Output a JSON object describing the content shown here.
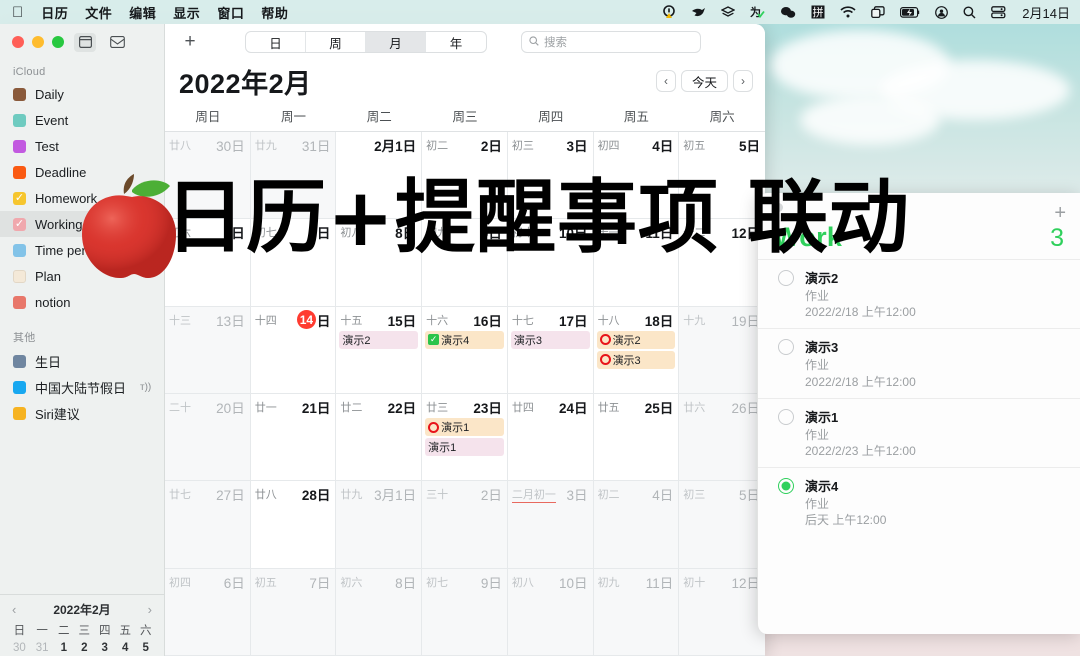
{
  "menubar": {
    "apple_icon": "apple-logo",
    "items": [
      "日历",
      "文件",
      "编辑",
      "显示",
      "窗口",
      "帮助"
    ],
    "status_icons": [
      "warning-badge-icon",
      "bird-icon",
      "layers-icon",
      "shield-check-icon",
      "wechat-icon",
      "pinyin-input-icon",
      "wifi-icon",
      "screen-mirroring-icon",
      "battery-charging-icon",
      "control-center-icon",
      "search-icon",
      "stack-icon"
    ],
    "clock": "2月14日"
  },
  "calendar": {
    "toolbar": {
      "add_label": "+",
      "views": [
        {
          "label": "日",
          "selected": false
        },
        {
          "label": "周",
          "selected": false
        },
        {
          "label": "月",
          "selected": true
        },
        {
          "label": "年",
          "selected": false
        }
      ],
      "search_placeholder": "搜索",
      "search_icon": "search-icon"
    },
    "month_title": "2022年2月",
    "nav": {
      "prev": "‹",
      "today": "今天",
      "next": "›"
    },
    "weekday_headers": [
      "周日",
      "周一",
      "周二",
      "周三",
      "周四",
      "周五",
      "周六"
    ],
    "sidebar": {
      "sections": [
        {
          "title": "iCloud",
          "items": [
            {
              "label": "Daily",
              "color": "#8a5a3b",
              "checked": false,
              "selected": false
            },
            {
              "label": "Event",
              "color": "#6ecbc0",
              "checked": false,
              "selected": false
            },
            {
              "label": "Test",
              "color": "#c25ae0",
              "checked": false,
              "selected": false
            },
            {
              "label": "Deadline",
              "color": "#fa5a12",
              "checked": false,
              "selected": false
            },
            {
              "label": "Homework",
              "color": "#f6c62e",
              "checked": true,
              "selected": false
            },
            {
              "label": "Working",
              "color": "#f0a8ad",
              "checked": true,
              "selected": true
            },
            {
              "label": "Time period",
              "color": "#82c3e8",
              "checked": false,
              "selected": false
            },
            {
              "label": "Plan",
              "color": "#f4e9d8",
              "checked": false,
              "selected": false
            },
            {
              "label": "notion",
              "color": "#e8776a",
              "checked": false,
              "selected": false
            }
          ]
        },
        {
          "title": "其他",
          "items": [
            {
              "label": "生日",
              "color": "#6f86a0",
              "checked": false,
              "selected": false,
              "bell": false
            },
            {
              "label": "中国大陆节假日",
              "color": "#18a8f0",
              "checked": false,
              "selected": false,
              "bell": true
            },
            {
              "label": "Siri建议",
              "color": "#f6b321",
              "checked": false,
              "selected": false,
              "bell": false
            }
          ]
        }
      ]
    },
    "minical": {
      "title": "2022年2月",
      "prev": "‹",
      "next": "›",
      "dow": [
        "日",
        "一",
        "二",
        "三",
        "四",
        "五",
        "六"
      ],
      "rows": [
        [
          {
            "d": "30",
            "out": true
          },
          {
            "d": "31",
            "out": true
          },
          {
            "d": "1",
            "out": false
          },
          {
            "d": "2",
            "out": false
          },
          {
            "d": "3",
            "out": false
          },
          {
            "d": "4",
            "out": false
          },
          {
            "d": "5",
            "out": false
          }
        ]
      ]
    },
    "weeks": [
      [
        {
          "lunar": "廿八",
          "num": "30日",
          "dim": true,
          "events": []
        },
        {
          "lunar": "廿九",
          "num": "31日",
          "dim": true,
          "events": []
        },
        {
          "lunar": "",
          "num": "2月1日",
          "dim": false,
          "events": []
        },
        {
          "lunar": "初二",
          "num": "2日",
          "dim": false,
          "events": []
        },
        {
          "lunar": "初三",
          "num": "3日",
          "dim": false,
          "events": []
        },
        {
          "lunar": "初四",
          "num": "4日",
          "dim": false,
          "events": []
        },
        {
          "lunar": "初五",
          "num": "5日",
          "dim": false,
          "events": []
        }
      ],
      [
        {
          "lunar": "初六",
          "num": "6日",
          "dim": false,
          "events": []
        },
        {
          "lunar": "初七",
          "num": "7日",
          "dim": false,
          "events": []
        },
        {
          "lunar": "初八",
          "num": "8日",
          "dim": false,
          "events": []
        },
        {
          "lunar": "初九",
          "num": "9日",
          "dim": false,
          "events": []
        },
        {
          "lunar": "初十",
          "num": "10日",
          "dim": false,
          "events": []
        },
        {
          "lunar": "十一",
          "num": "11日",
          "dim": false,
          "events": []
        },
        {
          "lunar": "十二",
          "num": "12日",
          "dim": false,
          "events": []
        }
      ],
      [
        {
          "lunar": "十三",
          "num": "13日",
          "dim": true,
          "events": []
        },
        {
          "lunar": "十四",
          "num": "14日",
          "dim": false,
          "today": true,
          "events": []
        },
        {
          "lunar": "十五",
          "num": "15日",
          "dim": false,
          "events": [
            {
              "label": "演示2",
              "style": "pink",
              "icon": "none"
            }
          ]
        },
        {
          "lunar": "十六",
          "num": "16日",
          "dim": false,
          "events": [
            {
              "label": "演示4",
              "style": "orange",
              "icon": "check"
            }
          ]
        },
        {
          "lunar": "十七",
          "num": "17日",
          "dim": false,
          "events": [
            {
              "label": "演示3",
              "style": "pink",
              "icon": "none"
            }
          ]
        },
        {
          "lunar": "十八",
          "num": "18日",
          "dim": false,
          "events": [
            {
              "label": "演示2",
              "style": "orange",
              "icon": "ring"
            },
            {
              "label": "演示3",
              "style": "orange",
              "icon": "ring"
            }
          ]
        },
        {
          "lunar": "十九",
          "num": "19日",
          "dim": true,
          "events": []
        }
      ],
      [
        {
          "lunar": "二十",
          "num": "20日",
          "dim": true,
          "events": []
        },
        {
          "lunar": "廿一",
          "num": "21日",
          "dim": false,
          "events": []
        },
        {
          "lunar": "廿二",
          "num": "22日",
          "dim": false,
          "events": []
        },
        {
          "lunar": "廿三",
          "num": "23日",
          "dim": false,
          "events": [
            {
              "label": "演示1",
              "style": "orange",
              "icon": "ring"
            },
            {
              "label": "演示1",
              "style": "pink",
              "icon": "none"
            }
          ]
        },
        {
          "lunar": "廿四",
          "num": "24日",
          "dim": false,
          "events": []
        },
        {
          "lunar": "廿五",
          "num": "25日",
          "dim": false,
          "events": []
        },
        {
          "lunar": "廿六",
          "num": "26日",
          "dim": true,
          "events": []
        }
      ],
      [
        {
          "lunar": "廿七",
          "num": "27日",
          "dim": true,
          "events": []
        },
        {
          "lunar": "廿八",
          "num": "28日",
          "dim": false,
          "events": []
        },
        {
          "lunar": "廿九",
          "num": "3月1日",
          "dim": true,
          "events": []
        },
        {
          "lunar": "三十",
          "num": "2日",
          "dim": true,
          "events": []
        },
        {
          "lunar": "二月初一",
          "num": "3日",
          "dim": true,
          "lunar_red": true,
          "events": []
        },
        {
          "lunar": "初二",
          "num": "4日",
          "dim": true,
          "events": []
        },
        {
          "lunar": "初三",
          "num": "5日",
          "dim": true,
          "events": []
        }
      ],
      [
        {
          "lunar": "初四",
          "num": "6日",
          "dim": true,
          "events": []
        },
        {
          "lunar": "初五",
          "num": "7日",
          "dim": true,
          "events": []
        },
        {
          "lunar": "初六",
          "num": "8日",
          "dim": true,
          "events": []
        },
        {
          "lunar": "初七",
          "num": "9日",
          "dim": true,
          "events": []
        },
        {
          "lunar": "初八",
          "num": "10日",
          "dim": true,
          "events": []
        },
        {
          "lunar": "初九",
          "num": "11日",
          "dim": true,
          "events": []
        },
        {
          "lunar": "初十",
          "num": "12日",
          "dim": true,
          "events": []
        }
      ]
    ]
  },
  "reminders": {
    "add_label": "+",
    "list_title": "Work",
    "count": "3",
    "accent_color": "#2fd05c",
    "items": [
      {
        "title": "演示2",
        "list": "作业",
        "due": "2022/2/18 上午12:00",
        "done": false
      },
      {
        "title": "演示3",
        "list": "作业",
        "due": "2022/2/18 上午12:00",
        "done": false
      },
      {
        "title": "演示1",
        "list": "作业",
        "due": "2022/2/23 上午12:00",
        "done": false
      },
      {
        "title": "演示4",
        "list": "作业",
        "due": "后天 上午12:00",
        "done": true
      }
    ]
  },
  "overlay": {
    "headline": "日历+提醒事项 联动",
    "sticker": "apple-emoji"
  }
}
